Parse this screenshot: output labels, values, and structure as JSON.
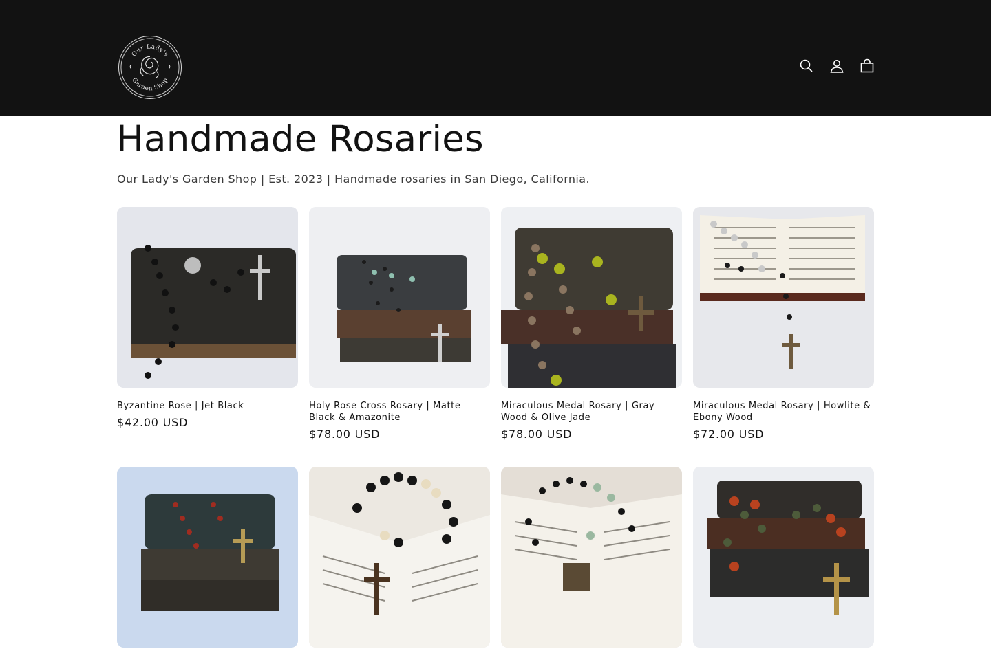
{
  "header": {
    "logo_text_top": "Our Lady's",
    "logo_text_bottom": "Garden Shop",
    "icons": [
      "search-icon",
      "account-icon",
      "cart-icon"
    ]
  },
  "collection": {
    "title": "Handmade Rosaries",
    "description": "Our Lady's Garden Shop | Est. 2023 | Handmade rosaries in San Diego, California."
  },
  "products": [
    {
      "title": "Byzantine Rose | Jet Black",
      "price": "$42.00 USD"
    },
    {
      "title": "Holy Rose Cross Rosary | Matte Black & Amazonite",
      "price": "$78.00 USD"
    },
    {
      "title": "Miraculous Medal Rosary | Gray Wood & Olive Jade",
      "price": "$78.00 USD"
    },
    {
      "title": "Miraculous Medal Rosary | Howlite & Ebony Wood",
      "price": "$72.00 USD"
    },
    {
      "title": "",
      "price": ""
    },
    {
      "title": "",
      "price": ""
    },
    {
      "title": "",
      "price": ""
    },
    {
      "title": "",
      "price": ""
    }
  ],
  "colors": {
    "header_bg": "#121212",
    "text": "#121212",
    "subtitle": "#3a3a3a"
  }
}
